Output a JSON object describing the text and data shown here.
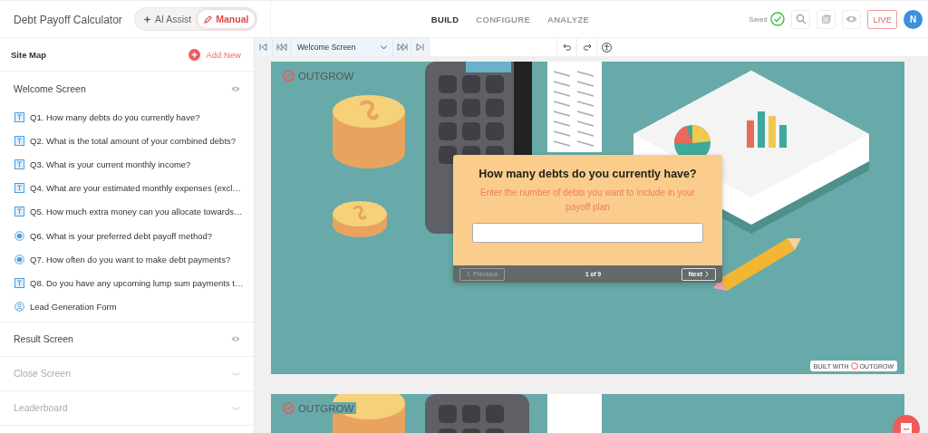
{
  "header": {
    "title": "Debt Payoff Calculator",
    "mode_toggle": [
      {
        "label": "AI Assist",
        "selected": false
      },
      {
        "label": "Manual",
        "selected": true
      }
    ],
    "tabs": [
      {
        "label": "BUILD",
        "selected": true
      },
      {
        "label": "CONFIGURE",
        "selected": false
      },
      {
        "label": "ANALYZE",
        "selected": false
      }
    ],
    "save_status": "Saved",
    "live_button": "LIVE",
    "avatar": "N"
  },
  "sidebar": {
    "title": "Site Map",
    "add_button": "Add New",
    "sections": [
      {
        "label": "Welcome Screen",
        "disabled": false,
        "children": [
          {
            "label": "Q1. How many debts do you currently have?",
            "kind": "text"
          },
          {
            "label": "Q2. What is the total amount of your combined debts?",
            "kind": "text"
          },
          {
            "label": "Q3. What is your current monthly income?",
            "kind": "text"
          },
          {
            "label": "Q4. What are your estimated monthly expenses (excl…",
            "kind": "text"
          },
          {
            "label": "Q5. How much extra money can you allocate towards…",
            "kind": "text"
          },
          {
            "label": "Q6. What is your preferred debt payoff method?",
            "kind": "choice"
          },
          {
            "label": "Q7. How often do you want to make debt payments?",
            "kind": "choice"
          },
          {
            "label": "Q8. Do you have any upcoming lump sum payments t…",
            "kind": "text"
          },
          {
            "label": "Lead Generation Form",
            "kind": "form"
          }
        ]
      },
      {
        "label": "Result Screen",
        "disabled": false
      },
      {
        "label": "Close Screen",
        "disabled": true
      },
      {
        "label": "Leaderboard",
        "disabled": true
      }
    ]
  },
  "toolbar": {
    "screen_select": "Welcome Screen"
  },
  "preview": {
    "brand": "OUTGROW",
    "question": "How many debts do you currently have?",
    "hint": "Enter the number of debts you want to include in your payoff plan",
    "previous_button": "Previous",
    "previous_disabled": true,
    "page_indicator": "1 of 9",
    "next_button": "Next",
    "badge_prefix": "BUILT WITH",
    "badge_brand": "OUTGROW"
  },
  "second_preview": {
    "brand": "OUTGROW"
  }
}
